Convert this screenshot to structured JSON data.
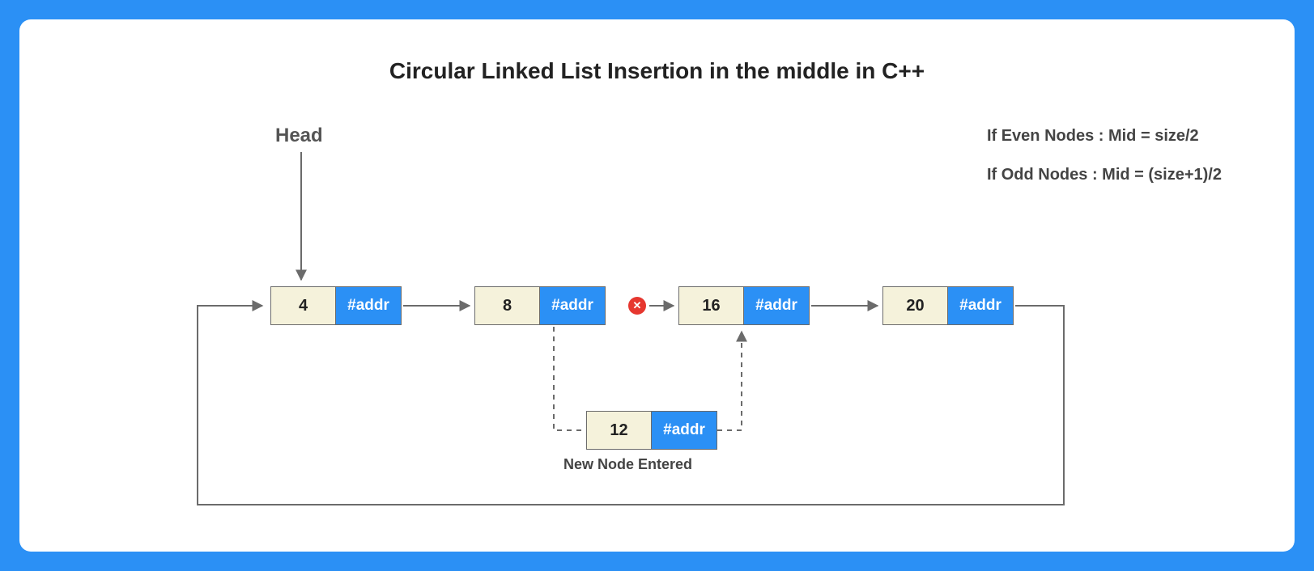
{
  "title": "Circular Linked List Insertion in the middle in C++",
  "head_label": "Head",
  "notes": {
    "even": "If Even Nodes : Mid = size/2",
    "odd": "If Odd Nodes : Mid = (size+1)/2"
  },
  "nodes": [
    {
      "value": "4",
      "addr": "#addr"
    },
    {
      "value": "8",
      "addr": "#addr"
    },
    {
      "value": "16",
      "addr": "#addr"
    },
    {
      "value": "20",
      "addr": "#addr"
    }
  ],
  "new_node": {
    "value": "12",
    "addr": "#addr",
    "caption": "New Node Entered"
  },
  "error_icon": "✕"
}
